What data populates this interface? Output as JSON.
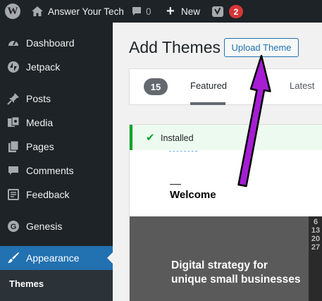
{
  "admin_bar": {
    "wp_logo": "W",
    "site_name": "Answer Your Tech",
    "comment_count": "0",
    "new_label": "New",
    "notification_count": "2"
  },
  "sidebar": {
    "items": [
      {
        "label": "Dashboard",
        "icon": "dashboard-icon"
      },
      {
        "label": "Jetpack",
        "icon": "jetpack-icon"
      },
      {
        "label": "Posts",
        "icon": "pin-icon"
      },
      {
        "label": "Media",
        "icon": "media-icon"
      },
      {
        "label": "Pages",
        "icon": "pages-icon"
      },
      {
        "label": "Comments",
        "icon": "comments-icon"
      },
      {
        "label": "Feedback",
        "icon": "feedback-icon"
      },
      {
        "label": "Genesis",
        "icon": "genesis-icon"
      },
      {
        "label": "Appearance",
        "icon": "brush-icon"
      }
    ],
    "active_item": "Appearance",
    "submenu": {
      "themes_label": "Themes"
    }
  },
  "main": {
    "title": "Add Themes",
    "upload_button": "Upload Theme",
    "filter": {
      "count": "15",
      "tabs": [
        "Featured",
        "Latest"
      ],
      "active_tab": "Featured"
    },
    "theme_card": {
      "installed_label": "Installed",
      "preview_heading": "Welcome",
      "hero_line1": "Digital strategy for",
      "hero_line2": "unique small businesses",
      "edge_digits": [
        "6",
        "13",
        "20",
        "27"
      ]
    }
  },
  "colors": {
    "adminbar_bg": "#1d2327",
    "accent_blue": "#2271b1",
    "installed_green": "#00a32a",
    "annotation_arrow": "#a61dd4",
    "badge_red": "#d63638"
  }
}
